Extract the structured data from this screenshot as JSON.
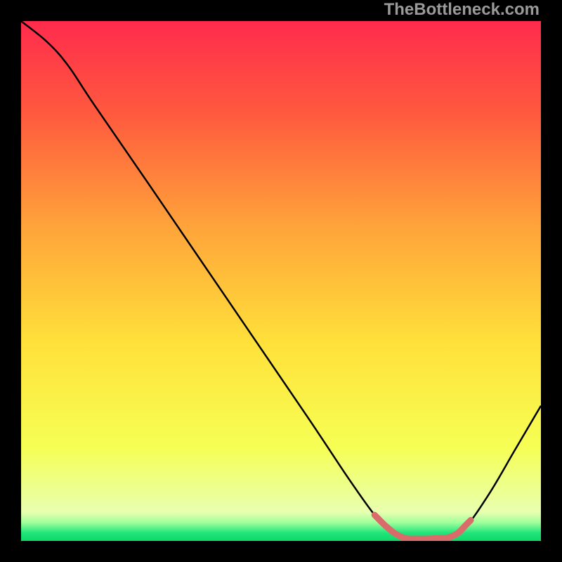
{
  "watermark": "TheBottleneck.com",
  "chart_data": {
    "type": "line",
    "title": "",
    "xlabel": "",
    "ylabel": "",
    "xlim": [
      0,
      100
    ],
    "ylim": [
      0,
      100
    ],
    "gradient_stops": [
      {
        "offset": 0,
        "color": "#ff2b4d"
      },
      {
        "offset": 0.18,
        "color": "#ff5a3e"
      },
      {
        "offset": 0.4,
        "color": "#ffa53a"
      },
      {
        "offset": 0.62,
        "color": "#ffe13a"
      },
      {
        "offset": 0.82,
        "color": "#f6ff54"
      },
      {
        "offset": 0.945,
        "color": "#e8ffb0"
      },
      {
        "offset": 0.965,
        "color": "#9dff9a"
      },
      {
        "offset": 0.985,
        "color": "#1fe47a"
      },
      {
        "offset": 1.0,
        "color": "#0fd968"
      }
    ],
    "series": [
      {
        "name": "curve",
        "points": [
          {
            "x": 0.0,
            "y": 100.0
          },
          {
            "x": 5.0,
            "y": 96.0
          },
          {
            "x": 9.0,
            "y": 91.5
          },
          {
            "x": 14.0,
            "y": 84.0
          },
          {
            "x": 25.0,
            "y": 68.0
          },
          {
            "x": 40.0,
            "y": 46.0
          },
          {
            "x": 55.0,
            "y": 24.0
          },
          {
            "x": 63.0,
            "y": 12.0
          },
          {
            "x": 68.0,
            "y": 5.0
          },
          {
            "x": 71.0,
            "y": 2.0
          },
          {
            "x": 74.0,
            "y": 0.5
          },
          {
            "x": 78.0,
            "y": 0.4
          },
          {
            "x": 82.0,
            "y": 0.6
          },
          {
            "x": 85.0,
            "y": 2.0
          },
          {
            "x": 90.0,
            "y": 9.0
          },
          {
            "x": 95.0,
            "y": 17.5
          },
          {
            "x": 100.0,
            "y": 26.0
          }
        ]
      },
      {
        "name": "bottom-highlight",
        "color": "#d96b6b",
        "thickness": 9,
        "points": [
          {
            "x": 68.0,
            "y": 5.0
          },
          {
            "x": 70.0,
            "y": 3.0
          },
          {
            "x": 72.0,
            "y": 1.4
          },
          {
            "x": 74.0,
            "y": 0.5
          },
          {
            "x": 76.0,
            "y": 0.4
          },
          {
            "x": 78.0,
            "y": 0.4
          },
          {
            "x": 80.0,
            "y": 0.5
          },
          {
            "x": 82.0,
            "y": 0.6
          },
          {
            "x": 84.0,
            "y": 1.5
          },
          {
            "x": 85.5,
            "y": 3.0
          },
          {
            "x": 86.5,
            "y": 4.0
          }
        ]
      }
    ]
  }
}
